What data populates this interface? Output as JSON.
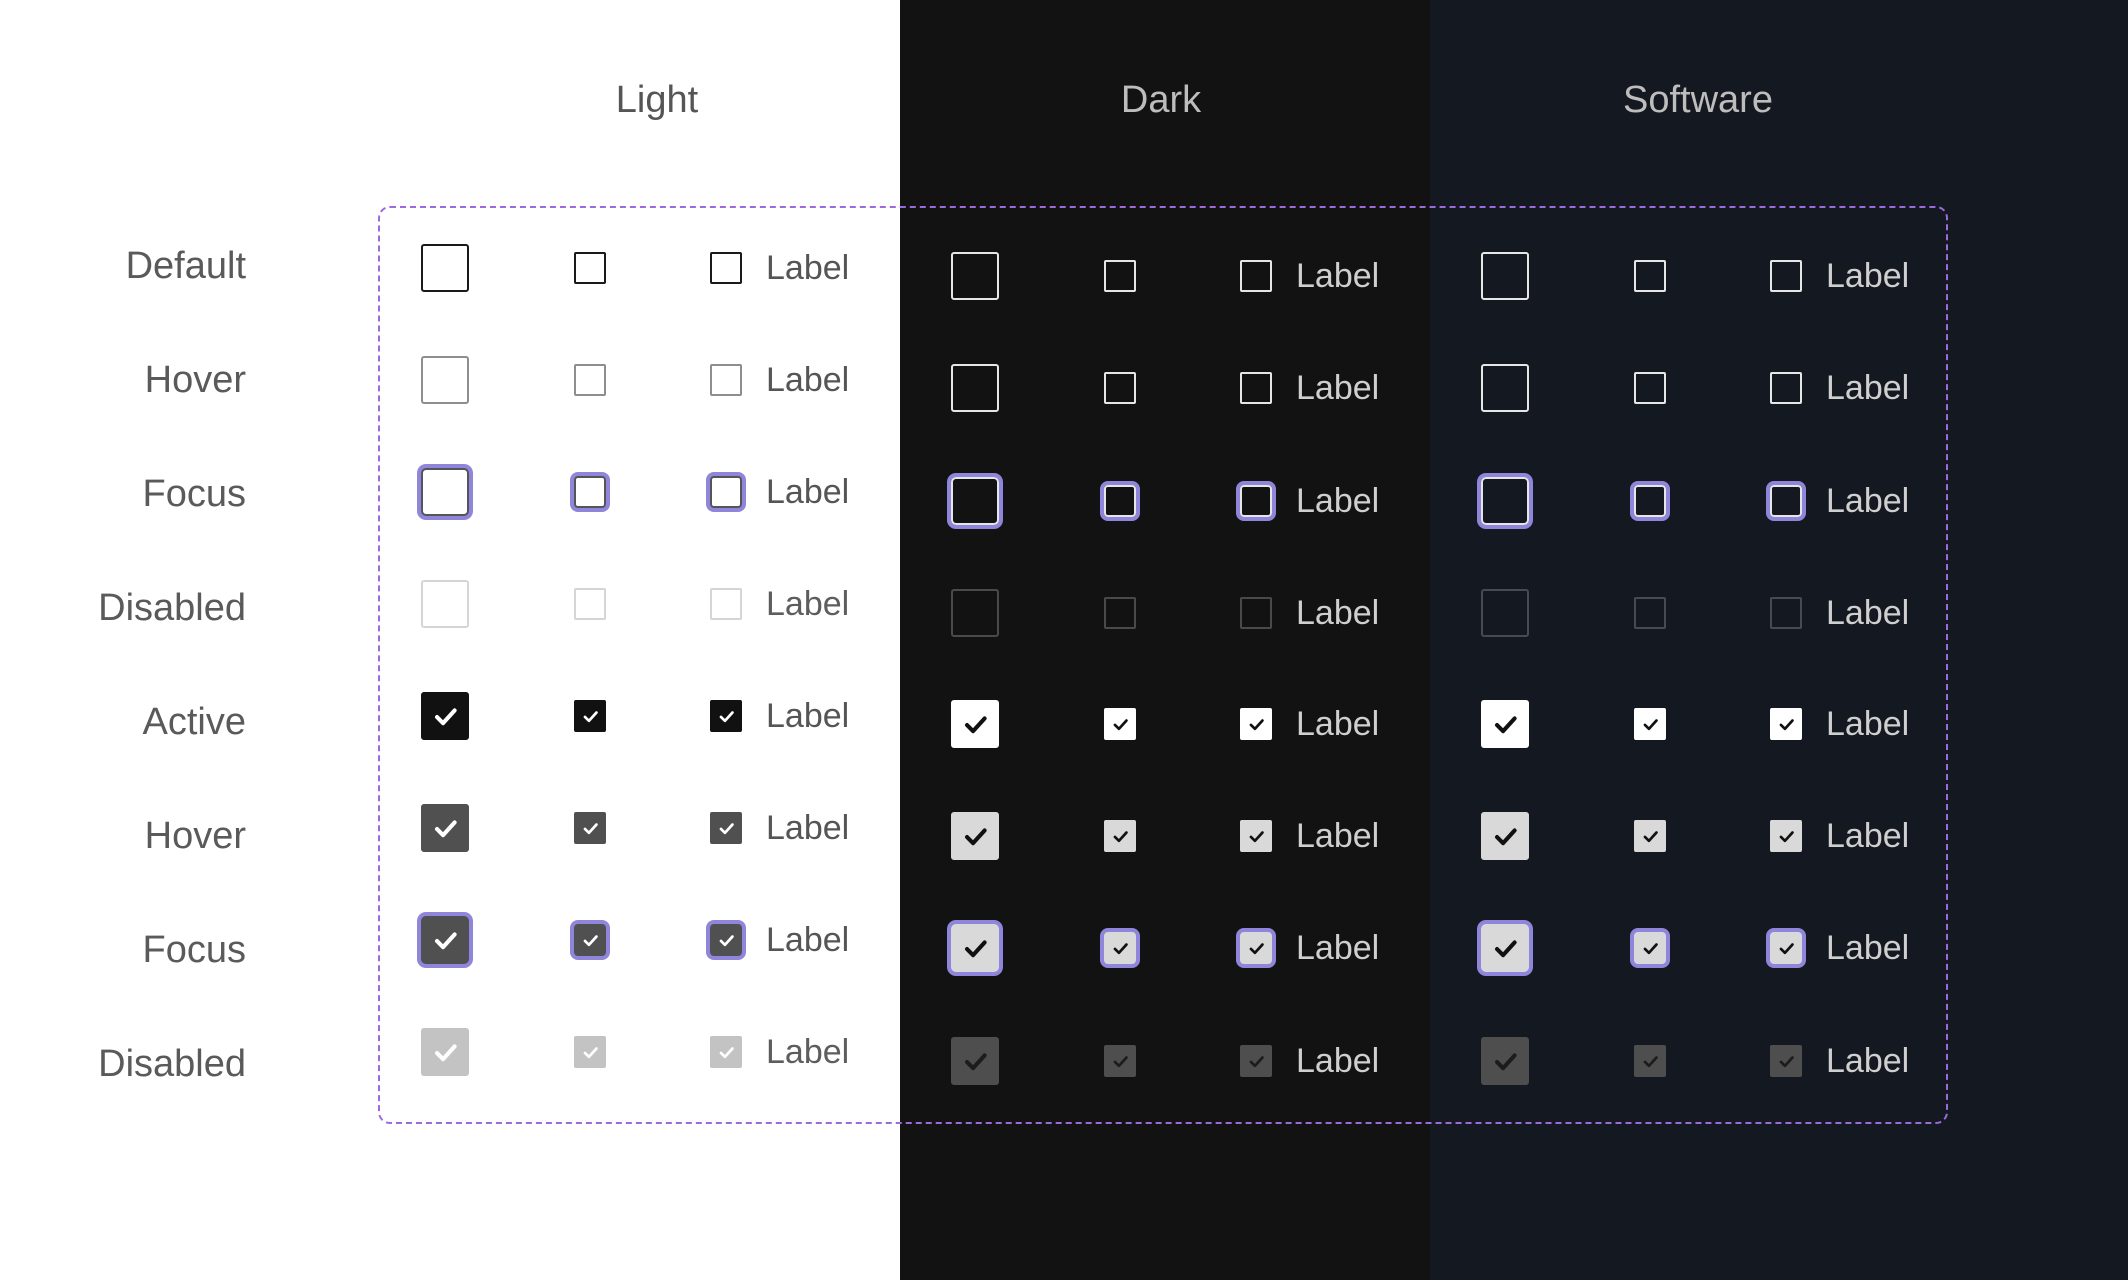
{
  "columns": [
    "Light",
    "Dark",
    "Software"
  ],
  "rows": [
    "Default",
    "Hover",
    "Focus",
    "Disabled",
    "Active",
    "Hover",
    "Focus",
    "Disabled"
  ],
  "checkbox_label": "Label",
  "colors": {
    "light_background": "#ffffff",
    "dark_background": "#121212",
    "software_background": "#141820",
    "focus_ring": "#8f86dc",
    "dashed_frame": "#9b6bde"
  },
  "icons": {
    "checked": "checkmark-icon"
  }
}
